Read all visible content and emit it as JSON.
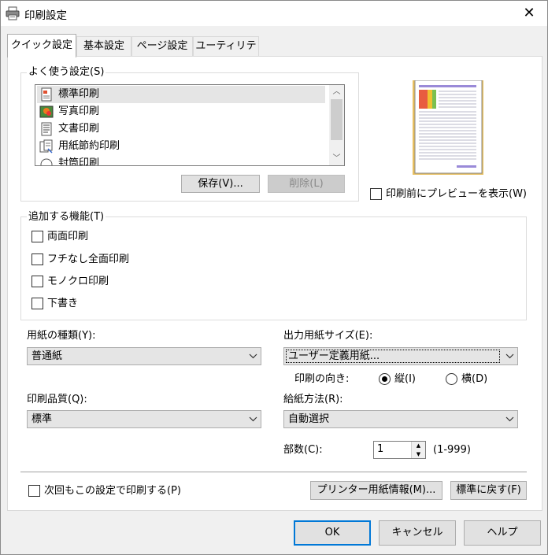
{
  "window": {
    "title": "印刷設定",
    "close_glyph": "✕"
  },
  "tabs": [
    {
      "label": "クイック設定",
      "active": true
    },
    {
      "label": "基本設定",
      "active": false
    },
    {
      "label": "ページ設定",
      "active": false
    },
    {
      "label": "ユーティリティ",
      "active": false
    }
  ],
  "frequent": {
    "label": "よく使う設定(S)",
    "items": [
      {
        "label": "標準印刷",
        "icon": "standard-print-icon",
        "selected": true
      },
      {
        "label": "写真印刷",
        "icon": "photo-print-icon",
        "selected": false
      },
      {
        "label": "文書印刷",
        "icon": "document-print-icon",
        "selected": false
      },
      {
        "label": "用紙節約印刷",
        "icon": "paper-saving-icon",
        "selected": false
      },
      {
        "label": "封筒印刷",
        "icon": "envelope-print-icon",
        "selected": false
      }
    ],
    "save_button": "保存(V)...",
    "delete_button": "削除(L)"
  },
  "preview": {
    "show_preview_label": "印刷前にプレビューを表示(W)",
    "checked": false
  },
  "additional": {
    "label": "追加する機能(T)",
    "options": [
      {
        "label": "両面印刷",
        "checked": false
      },
      {
        "label": "フチなし全面印刷",
        "checked": false
      },
      {
        "label": "モノクロ印刷",
        "checked": false
      },
      {
        "label": "下書き",
        "checked": false
      }
    ]
  },
  "paper_type": {
    "label": "用紙の種類(Y):",
    "value": "普通紙"
  },
  "output_size": {
    "label": "出力用紙サイズ(E):",
    "value": "ユーザー定義用紙..."
  },
  "orientation": {
    "label": "印刷の向き:",
    "portrait": "縦(I)",
    "landscape": "横(D)",
    "selected": "portrait"
  },
  "quality": {
    "label": "印刷品質(Q):",
    "value": "標準"
  },
  "paper_source": {
    "label": "給紙方法(R):",
    "value": "自動選択"
  },
  "copies": {
    "label": "部数(C):",
    "value": "1",
    "range": "(1-999)"
  },
  "always_use": {
    "label": "次回もこの設定で印刷する(P)",
    "checked": false
  },
  "printer_media_button": "プリンター用紙情報(M)...",
  "restore_defaults_button": "標準に戻す(F)",
  "footer": {
    "ok": "OK",
    "cancel": "キャンセル",
    "help": "ヘルプ"
  },
  "colors": {
    "accent": "#0078d7",
    "panel": "#ffffff",
    "dialog": "#f0f0f0"
  }
}
